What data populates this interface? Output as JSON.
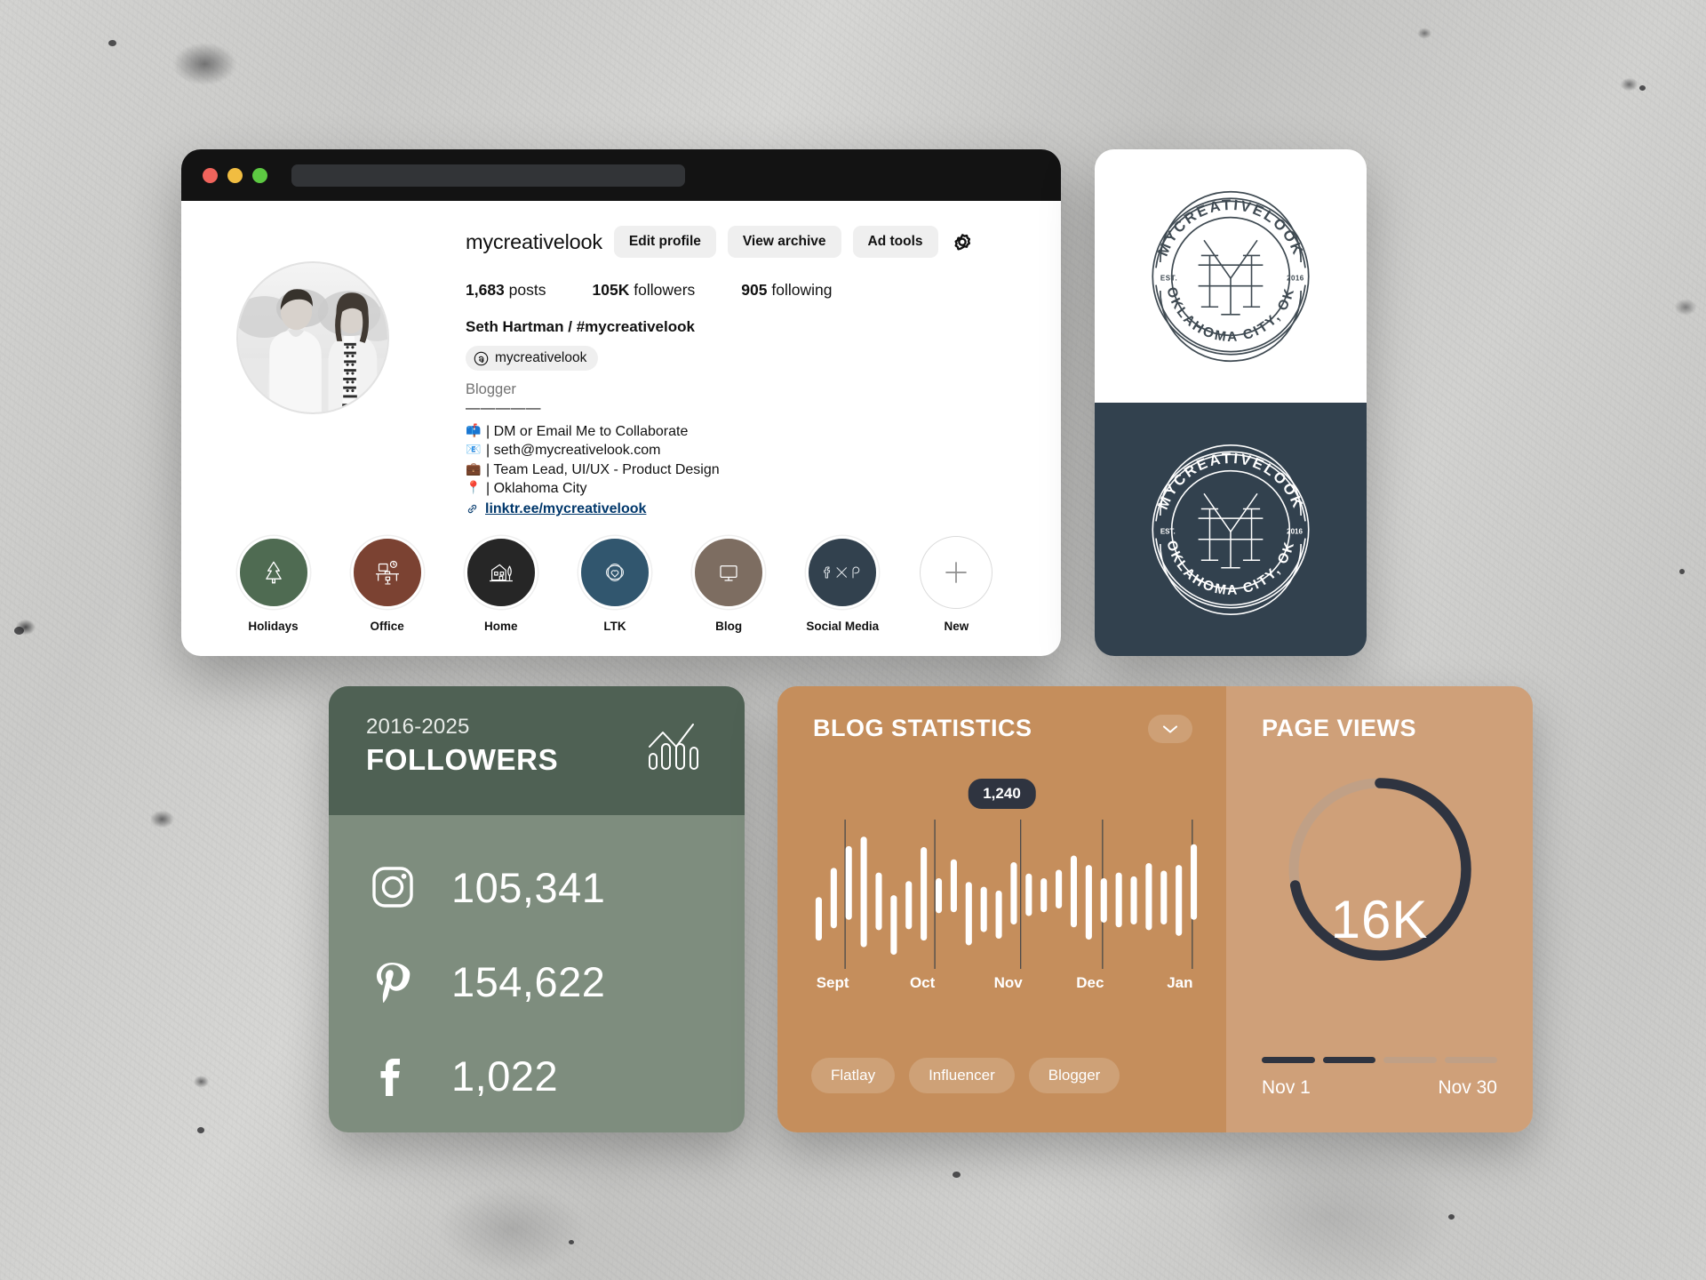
{
  "browser": {
    "traffic_lights": [
      "close",
      "minimize",
      "maximize"
    ],
    "url_value": ""
  },
  "profile": {
    "username": "mycreativelook",
    "buttons": [
      {
        "label": "Edit profile",
        "name": "edit-profile-button"
      },
      {
        "label": "View archive",
        "name": "view-archive-button"
      },
      {
        "label": "Ad tools",
        "name": "ad-tools-button"
      }
    ],
    "settings_icon": "gear-icon",
    "stats": [
      {
        "value": "1,683",
        "label": "posts"
      },
      {
        "value": "105K",
        "label": "followers"
      },
      {
        "value": "905",
        "label": "following"
      }
    ],
    "full_name": "Seth Hartman / #mycreativelook",
    "threads_handle": "mycreativelook",
    "role": "Blogger",
    "divider": "—————",
    "bio_lines": [
      {
        "emoji": "📫",
        "text": "| DM or Email Me to Collaborate"
      },
      {
        "emoji": "📧",
        "text": "| seth@mycreativelook.com"
      },
      {
        "emoji": "💼",
        "text": "| Team Lead, UI/UX - Product Design"
      },
      {
        "emoji": "📍",
        "text": "| Oklahoma City"
      }
    ],
    "link": "linktr.ee/mycreativelook",
    "highlights": [
      {
        "label": "Holidays",
        "color": "#4f6b52",
        "icon": "tree-icon"
      },
      {
        "label": "Office",
        "color": "#7b4232",
        "icon": "desk-icon"
      },
      {
        "label": "Home",
        "color": "#262626",
        "icon": "house-icon"
      },
      {
        "label": "LTK",
        "color": "#31566e",
        "icon": "ltk-heart-icon"
      },
      {
        "label": "Blog",
        "color": "#7d6d61",
        "icon": "monitor-icon"
      },
      {
        "label": "Social Media",
        "color": "#32414e",
        "icon": "social-icons"
      },
      {
        "label": "New",
        "color": "#ffffff",
        "icon": "plus-icon"
      }
    ]
  },
  "logo": {
    "top_arc": "MYCREATIVELOOK",
    "bottom_arc": "OKLAHOMA CITY, OK",
    "est_label": "EST.",
    "est_year": "2016",
    "monogram": "M",
    "light_bg": "#ffffff",
    "dark_bg": "#32414e"
  },
  "followers_card": {
    "period": "2016-2025",
    "title": "FOLLOWERS",
    "header_color": "#4f6154",
    "body_color": "#7e8d7e",
    "chart_icon": "line-bar-chart-icon",
    "rows": [
      {
        "platform": "instagram-icon",
        "value": "105,341"
      },
      {
        "platform": "pinterest-icon",
        "value": "154,622"
      },
      {
        "platform": "facebook-icon",
        "value": "1,022"
      }
    ]
  },
  "blog_stats": {
    "title": "BLOG STATISTICS",
    "collapse_icon": "chevron-down-icon",
    "badge_value": "1,240",
    "bg_color": "#c58e5c",
    "tags": [
      "Flatlay",
      "Influencer",
      "Blogger"
    ]
  },
  "page_views": {
    "title": "PAGE VIEWS",
    "value": "16K",
    "bg_color": "#cfa079",
    "arc_color": "#2f3440",
    "track_color": "#c0a086",
    "progress_percent": 72,
    "segments": [
      "dark",
      "dark",
      "light",
      "light"
    ],
    "date_start": "Nov 1",
    "date_end": "Nov 30"
  },
  "chart_data": {
    "type": "bar",
    "title": "BLOG STATISTICS",
    "subtitle": "Floating / candlestick daily range bars",
    "xlabel": "",
    "ylabel": "",
    "categories": [
      "Sept",
      "Oct",
      "Nov",
      "Dec",
      "Jan"
    ],
    "tick_positions": [
      0.055,
      0.285,
      0.505,
      0.715,
      0.945
    ],
    "highlight_value": "1,240",
    "ylim": [
      0,
      1600
    ],
    "grid": false,
    "legend": "none",
    "bars": [
      {
        "low": 300,
        "high": 760
      },
      {
        "low": 430,
        "high": 1070
      },
      {
        "low": 520,
        "high": 1300
      },
      {
        "low": 230,
        "high": 1400
      },
      {
        "low": 410,
        "high": 1020
      },
      {
        "low": 150,
        "high": 780
      },
      {
        "low": 420,
        "high": 930
      },
      {
        "low": 300,
        "high": 1290
      },
      {
        "low": 590,
        "high": 960
      },
      {
        "low": 600,
        "high": 1160
      },
      {
        "low": 250,
        "high": 920
      },
      {
        "low": 390,
        "high": 870
      },
      {
        "low": 320,
        "high": 830
      },
      {
        "low": 470,
        "high": 1130
      },
      {
        "low": 560,
        "high": 1010
      },
      {
        "low": 600,
        "high": 960
      },
      {
        "low": 640,
        "high": 1050
      },
      {
        "low": 440,
        "high": 1200
      },
      {
        "low": 310,
        "high": 1100
      },
      {
        "low": 490,
        "high": 960
      },
      {
        "low": 440,
        "high": 1020
      },
      {
        "low": 470,
        "high": 980
      },
      {
        "low": 410,
        "high": 1120
      },
      {
        "low": 470,
        "high": 1040
      },
      {
        "low": 350,
        "high": 1100
      },
      {
        "low": 520,
        "high": 1320
      }
    ]
  }
}
